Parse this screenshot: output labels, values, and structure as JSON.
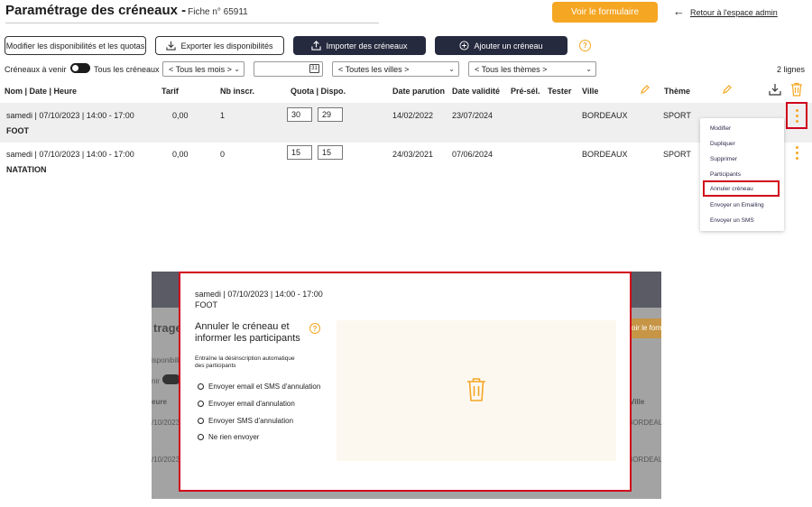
{
  "header": {
    "title": "Paramétrage des créneaux -",
    "subtitle": "Fiche n° 65911",
    "view_form_label": "Voir le formulaire",
    "back_arrow": "←",
    "back_label": "Retour à l'espace admin"
  },
  "toolbar": {
    "modify_label": "Modifier les disponibilités et les quotas",
    "export_label": "Exporter les disponibilités",
    "import_label": "Importer des créneaux",
    "add_label": "Ajouter un créneau",
    "help": "?"
  },
  "filters": {
    "upcoming_label": "Créneaux à venir",
    "all_label": "Tous les créneaux",
    "months": "< Tous les mois >",
    "date_value": "",
    "calendar_icon_text": "31",
    "cities": "< Toutes les villes >",
    "themes": "< Tous les thèmes >",
    "count": "2 lignes"
  },
  "table": {
    "headers": {
      "name": "Nom | Date | Heure",
      "price": "Tarif",
      "registered": "Nb inscr.",
      "quota": "Quota | Dispo.",
      "publish": "Date parution",
      "validity": "Date validité",
      "presel": "Pré-sél.",
      "tester": "Tester",
      "city": "Ville",
      "theme": "Thème"
    },
    "rows": [
      {
        "datetime": "samedi | 07/10/2023 | 14:00 - 17:00",
        "name": "FOOT",
        "price": "0,00",
        "registered": "1",
        "quota": "30",
        "available": "29",
        "publish": "14/02/2022",
        "validity": "23/07/2024",
        "city": "BORDEAUX",
        "theme": "SPORT"
      },
      {
        "datetime": "samedi | 07/10/2023 | 14:00 - 17:00",
        "name": "NATATION",
        "price": "0,00",
        "registered": "0",
        "quota": "15",
        "available": "15",
        "publish": "24/03/2021",
        "validity": "07/06/2024",
        "city": "BORDEAUX",
        "theme": "SPORT"
      }
    ]
  },
  "menu": {
    "items": [
      "Modifier",
      "Dupliquer",
      "Supprimer",
      "Participants",
      "Annuler créneau",
      "Envoyer un Emailing",
      "Envoyer un SMS"
    ],
    "highlighted": "Annuler créneau"
  },
  "background": {
    "title_fragment": "trage",
    "button_fragment": "oir le form",
    "toolbar_fragment": "isponibili",
    "filter_fragment": "nir",
    "header_fragment": "eure",
    "city_header": "Ville",
    "date_fragment_1": "/10/2023",
    "date_fragment_2": "/10/2023",
    "city_1": "BORDEAUX",
    "city_2": "BORDEAUX"
  },
  "modal": {
    "datetime": "samedi | 07/10/2023 | 14:00 - 17:00",
    "name": "FOOT",
    "heading_line1": "Annuler le créneau et",
    "heading_line2": "informer les participants",
    "help": "?",
    "desc_line1": "Entraîne la désinscription automatique",
    "desc_line2": "des participants",
    "options": [
      "Envoyer email et SMS d'annulation",
      "Envoyer email d'annulation",
      "Envoyer SMS d'annulation",
      "Ne rien envoyer"
    ]
  },
  "colors": {
    "accent": "#f5a623",
    "dark_button": "#262a3e",
    "highlight": "#d0021b"
  }
}
